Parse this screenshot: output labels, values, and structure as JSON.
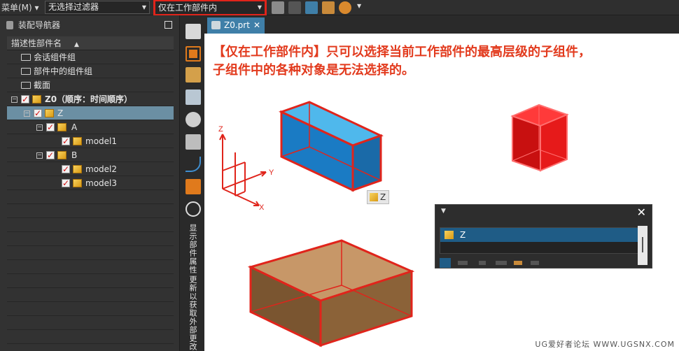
{
  "toolbar": {
    "menu_label": "菜单(M)",
    "filter_value": "无选择过滤器",
    "scope_value": "仅在工作部件内"
  },
  "navigator": {
    "title": "装配导航器",
    "column_header": "描述性部件名",
    "rows": [
      {
        "label": "会话组件组"
      },
      {
        "label": "部件中的组件组"
      },
      {
        "label": "截面"
      },
      {
        "label": "Z0（顺序：时间顺序）"
      },
      {
        "label": "Z"
      },
      {
        "label": "A"
      },
      {
        "label": "model1"
      },
      {
        "label": "B"
      },
      {
        "label": "model2"
      },
      {
        "label": "model3"
      }
    ]
  },
  "strip": {
    "vtext1": "显示部件属性",
    "vtext2": "更新以获取外部更改"
  },
  "tab": {
    "label": "Z0.prt",
    "close": "✕"
  },
  "canvas": {
    "note_line1": "【仅在工作部件内】只可以选择当前工作部件的最高层级的子组件，",
    "note_line2": "子组件中的各种对象是无法选择的。",
    "axis_z": "Z",
    "axis_y": "Y",
    "axis_x": "X",
    "hover_tag": "Z",
    "watermark": "UG爱好者论坛 WWW.UGSNX.COM"
  },
  "popup": {
    "close": "✕",
    "item": "Z"
  },
  "colors": {
    "accent": "#3f7fa8",
    "highlight_red": "#e0241b",
    "selection": "#6b8fa3"
  }
}
